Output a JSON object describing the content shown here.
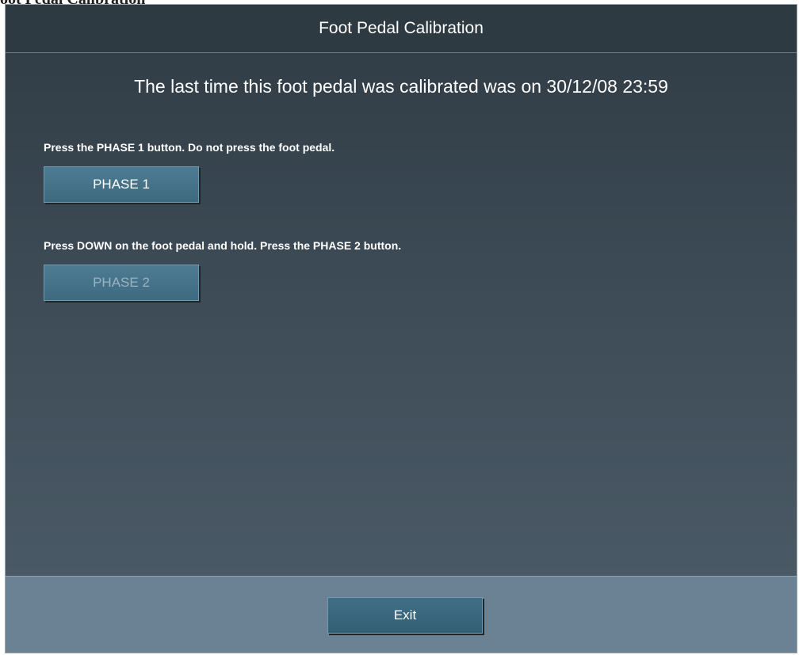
{
  "page_header": "oot Pedal Calibration",
  "window": {
    "title": "Foot Pedal Calibration",
    "last_calibration": "The last time this foot pedal was calibrated was on 30/12/08 23:59"
  },
  "phase1": {
    "instruction": "Press the PHASE 1 button. Do not press the foot pedal.",
    "button_label": "PHASE 1",
    "enabled": true
  },
  "phase2": {
    "instruction": "Press DOWN on the foot pedal and hold. Press the PHASE 2 button.",
    "button_label": "PHASE 2",
    "enabled": false
  },
  "footer": {
    "exit_label": "Exit"
  },
  "colors": {
    "title_bar": "#2e3a42",
    "button": "#3e6a80",
    "footer": "#6b8295",
    "disabled_text": "#9bb2bf"
  }
}
